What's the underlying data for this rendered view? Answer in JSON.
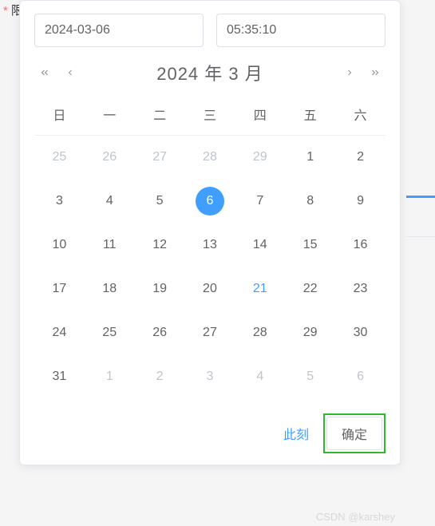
{
  "label": {
    "text": "限制完成时长",
    "required": "*"
  },
  "inputs": {
    "date": "2024-03-06",
    "time": "05:35:10"
  },
  "header": {
    "year": "2024 年",
    "month": "3 月"
  },
  "weekdays": [
    "日",
    "一",
    "二",
    "三",
    "四",
    "五",
    "六"
  ],
  "days": [
    [
      {
        "d": "25",
        "o": true
      },
      {
        "d": "26",
        "o": true
      },
      {
        "d": "27",
        "o": true
      },
      {
        "d": "28",
        "o": true
      },
      {
        "d": "29",
        "o": true
      },
      {
        "d": "1"
      },
      {
        "d": "2"
      }
    ],
    [
      {
        "d": "3"
      },
      {
        "d": "4"
      },
      {
        "d": "5"
      },
      {
        "d": "6",
        "sel": true
      },
      {
        "d": "7"
      },
      {
        "d": "8"
      },
      {
        "d": "9"
      }
    ],
    [
      {
        "d": "10"
      },
      {
        "d": "11"
      },
      {
        "d": "12"
      },
      {
        "d": "13"
      },
      {
        "d": "14"
      },
      {
        "d": "15"
      },
      {
        "d": "16"
      }
    ],
    [
      {
        "d": "17"
      },
      {
        "d": "18"
      },
      {
        "d": "19"
      },
      {
        "d": "20"
      },
      {
        "d": "21",
        "today": true
      },
      {
        "d": "22"
      },
      {
        "d": "23"
      }
    ],
    [
      {
        "d": "24"
      },
      {
        "d": "25"
      },
      {
        "d": "26"
      },
      {
        "d": "27"
      },
      {
        "d": "28"
      },
      {
        "d": "29"
      },
      {
        "d": "30"
      }
    ],
    [
      {
        "d": "31"
      },
      {
        "d": "1",
        "o": true
      },
      {
        "d": "2",
        "o": true
      },
      {
        "d": "3",
        "o": true
      },
      {
        "d": "4",
        "o": true
      },
      {
        "d": "5",
        "o": true
      },
      {
        "d": "6",
        "o": true
      }
    ]
  ],
  "footer": {
    "now": "此刻",
    "confirm": "确定"
  },
  "watermark": "CSDN @karshey"
}
